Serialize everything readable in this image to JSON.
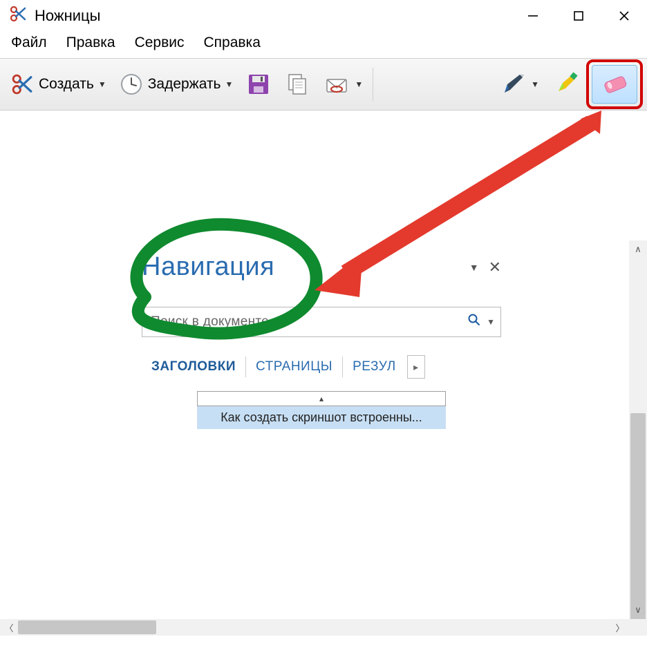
{
  "window": {
    "title": "Ножницы"
  },
  "menu": {
    "file": "Файл",
    "edit": "Правка",
    "tools": "Сервис",
    "help": "Справка"
  },
  "toolbar": {
    "new_label": "Создать",
    "delay_label": "Задержать"
  },
  "navpane": {
    "title": "Навигация",
    "search_placeholder": "Поиск в документе",
    "tabs": {
      "headings": "ЗАГОЛОВКИ",
      "pages": "СТРАНИЦЫ",
      "results": "РЕЗУЛ"
    },
    "item": "Как создать скриншот встроенны..."
  }
}
